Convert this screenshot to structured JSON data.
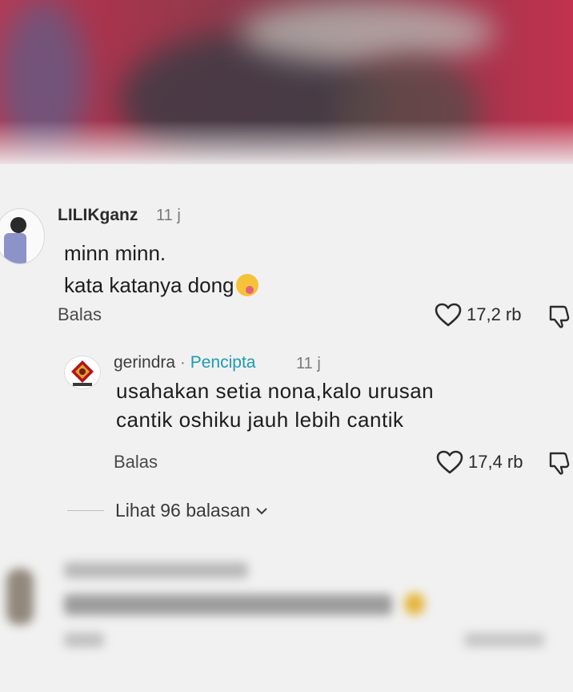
{
  "comments": [
    {
      "author": "LILIKganz",
      "time": "11 j",
      "text_line1": "minn minn.",
      "text_line2": "kata katanya dong",
      "reply_label": "Balas",
      "likes": "17,2 rb",
      "icons": {
        "like": "heart-icon",
        "dislike": "thumbs-down-icon",
        "avatar": "user-avatar"
      }
    },
    {
      "author": "gerindra",
      "separator": " · ",
      "badge": "Pencipta",
      "time": "11 j",
      "text_line1": "usahakan setia nona,kalo urusan",
      "text_line2": "cantik oshiku jauh lebih cantik",
      "reply_label": "Balas",
      "likes": "17,4 rb",
      "icons": {
        "like": "heart-icon",
        "dislike": "thumbs-down-icon",
        "avatar": "garuda-logo-avatar"
      }
    }
  ],
  "view_replies": {
    "label": "Lihat 96 balasan",
    "icon": "chevron-down-icon"
  },
  "colors": {
    "creator_badge": "#1e9ab0",
    "video_bg": "#a8344d"
  }
}
